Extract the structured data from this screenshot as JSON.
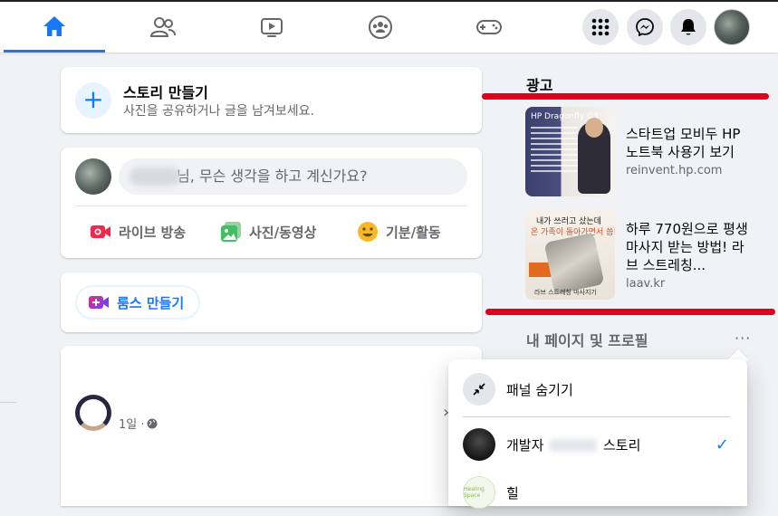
{
  "stories": {
    "title": "스토리 만들기",
    "subtitle": "사진을 공유하거나 글을 남겨보세요."
  },
  "composer": {
    "placeholder": "님, 무슨 생각을 하고 계신가요?",
    "actions": [
      {
        "label": "라이브 방송",
        "icon": "live-video-icon",
        "color": "#f02849"
      },
      {
        "label": "사진/동영상",
        "icon": "photo-video-icon",
        "color": "#45bd62"
      },
      {
        "label": "기분/활동",
        "icon": "feeling-icon",
        "color": "#f7b928"
      }
    ]
  },
  "rooms": {
    "label": "룸스 만들기"
  },
  "post": {
    "time": "1일 · ",
    "privacy_icon": "globe-icon"
  },
  "ads": {
    "heading": "광고",
    "items": [
      {
        "title": "스타트업 모비두 HP 노트북 사용기 보기",
        "domain": "reinvent.hp.com",
        "image_caption": "HP Dragonfly G3"
      },
      {
        "title": "하루 770원으로 평생 마사지 받는 방법! 라브 스트레칭...",
        "domain": "laav.kr",
        "image_line1": "내가 쓰러고 샀는데",
        "image_line2": "온 가족이 돌아가면서 씀!",
        "image_caption": "라브 스트레칭 마사지기"
      }
    ]
  },
  "pages": {
    "heading": "내 페이지 및 프로필",
    "more": "···"
  },
  "menu": {
    "hide_panel": "패널 숨기기",
    "page1_prefix": "개발자",
    "page1_suffix": "스토리",
    "page2": "힐"
  },
  "colors": {
    "accent": "#1877f2",
    "highlight": "#e0001b",
    "background": "#f0f2f5"
  }
}
